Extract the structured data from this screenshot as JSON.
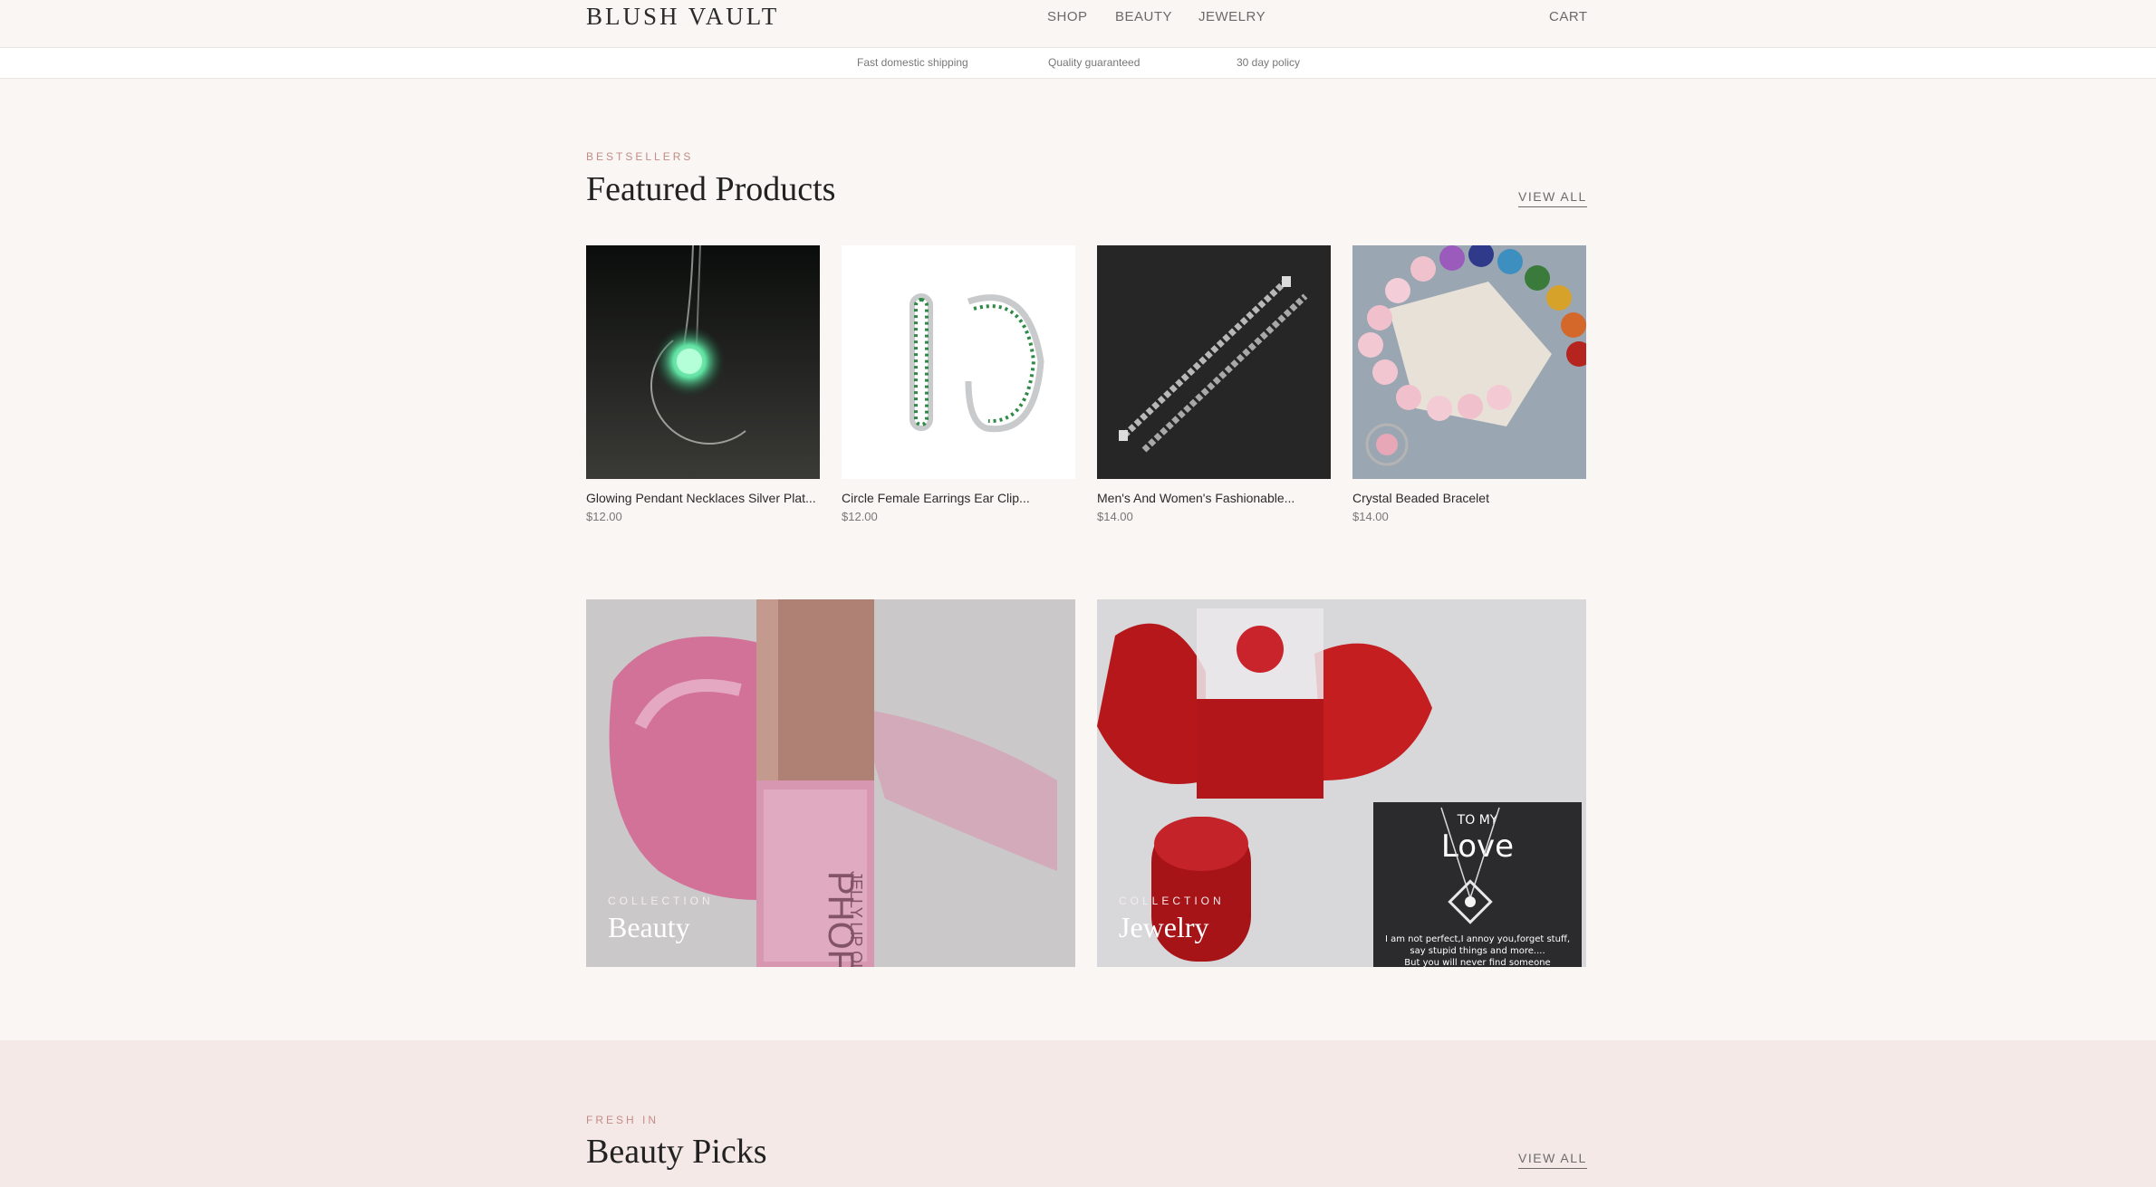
{
  "header": {
    "logo": "BLUSH VAULT",
    "nav": [
      {
        "label": "SHOP"
      },
      {
        "label": "BEAUTY"
      },
      {
        "label": "JEWELRY"
      }
    ],
    "cart_label": "CART"
  },
  "trust_strip": [
    "Fast domestic shipping",
    "Quality guaranteed",
    "30 day policy"
  ],
  "featured": {
    "eyebrow": "BESTSELLERS",
    "title": "Featured Products",
    "view_all": "VIEW ALL",
    "products": [
      {
        "name": "Glowing Pendant Necklaces Silver Plat...",
        "price": "$12.00"
      },
      {
        "name": "Circle Female Earrings Ear Clip...",
        "price": "$12.00"
      },
      {
        "name": "Men's And Women's Fashionable...",
        "price": "$14.00"
      },
      {
        "name": "Crystal Beaded Bracelet",
        "price": "$14.00"
      }
    ]
  },
  "collections": [
    {
      "eyebrow": "COLLECTION",
      "title": "Beauty",
      "image_text": "PHOFAY",
      "image_subtext": "JELLY LIP OIL"
    },
    {
      "eyebrow": "COLLECTION",
      "title": "Jewelry",
      "image_text": "TO MY",
      "image_subtext": "Love",
      "image_note": [
        "I am not perfect,I annoy you,forget stuff,",
        "say stupid things and more....",
        "But you will never find someone"
      ]
    }
  ],
  "beauty_picks": {
    "eyebrow": "FRESH IN",
    "title": "Beauty Picks",
    "view_all": "VIEW ALL"
  }
}
